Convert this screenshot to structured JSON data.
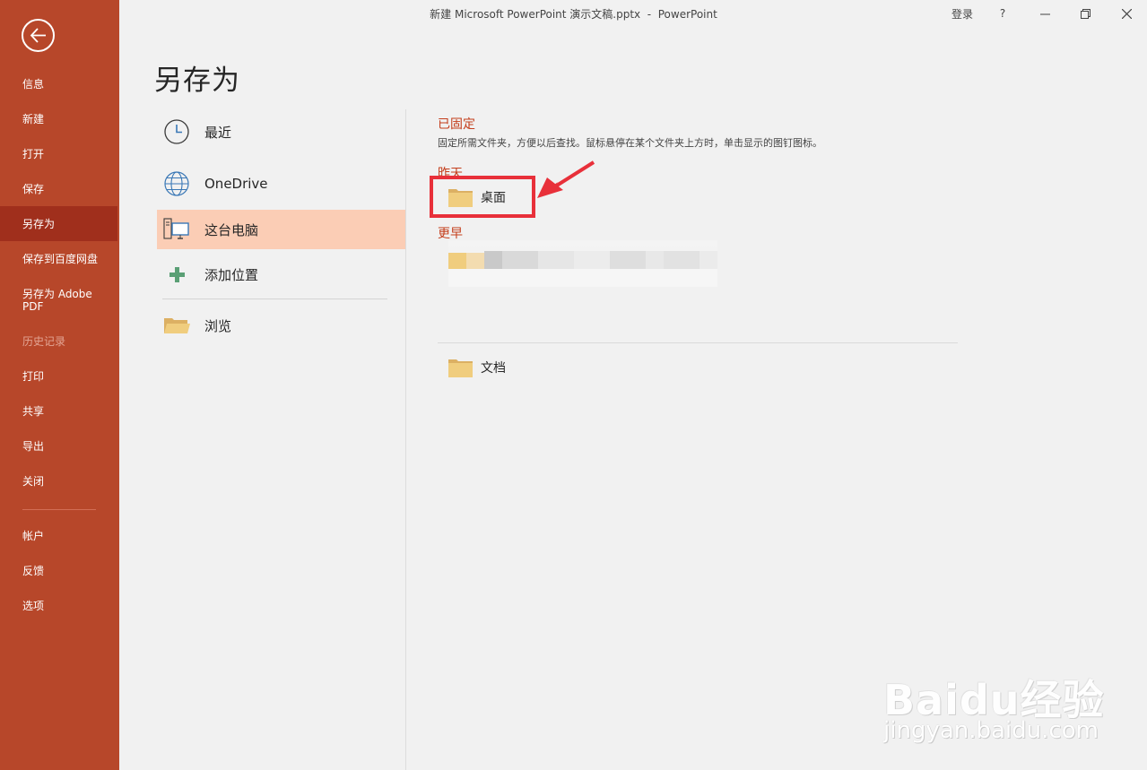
{
  "window": {
    "title": "新建 Microsoft PowerPoint 演示文稿.pptx  -  PowerPoint",
    "controls": {
      "login": "登录",
      "help": "?",
      "minimize": "—",
      "restore": "⧉",
      "close": "✕"
    }
  },
  "sidebar": {
    "items": [
      {
        "label": "信息"
      },
      {
        "label": "新建"
      },
      {
        "label": "打开"
      },
      {
        "label": "保存"
      },
      {
        "label": "另存为"
      },
      {
        "label": "保存到百度网盘"
      },
      {
        "label": "另存为 Adobe\nPDF"
      },
      {
        "label": "历史记录"
      },
      {
        "label": "打印"
      },
      {
        "label": "共享"
      },
      {
        "label": "导出"
      },
      {
        "label": "关闭"
      },
      {
        "label": "帐户"
      },
      {
        "label": "反馈"
      },
      {
        "label": "选项"
      }
    ],
    "active": "另存为",
    "colors": {
      "background": "#b7472a",
      "active": "#a02f1c"
    }
  },
  "page": {
    "heading": "另存为"
  },
  "locations": [
    {
      "label": "最近",
      "icon": "clock-icon"
    },
    {
      "label": "OneDrive",
      "icon": "globe-icon"
    },
    {
      "label": "这台电脑",
      "icon": "computer-icon",
      "selected": true
    },
    {
      "label": "添加位置",
      "icon": "plus-icon"
    },
    {
      "label": "浏览",
      "icon": "open-folder-icon"
    }
  ],
  "panel": {
    "pinned": {
      "heading": "已固定",
      "description": "固定所需文件夹，方便以后查找。鼠标悬停在某个文件夹上方时，单击显示的图钉图标。"
    },
    "yesterday": {
      "heading": "昨天",
      "folders": [
        "桌面"
      ]
    },
    "earlier": {
      "heading": "更早"
    },
    "other_folders": [
      "文档"
    ]
  },
  "watermark": {
    "brand": "Baidu经验",
    "url": "jingyan.baidu.com"
  }
}
